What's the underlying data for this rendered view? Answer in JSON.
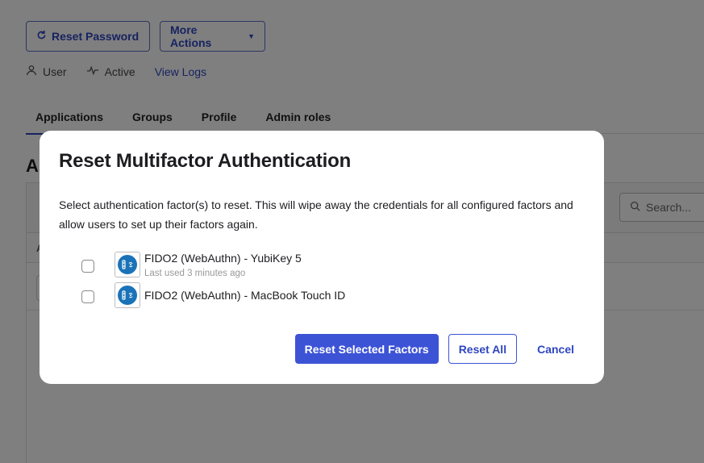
{
  "background": {
    "actions": {
      "reset_password": "Reset Password",
      "more_actions": "More Actions"
    },
    "meta": {
      "role": "User",
      "status": "Active",
      "logs_link": "View Logs"
    },
    "tabs": [
      {
        "label": "Applications",
        "active": true
      },
      {
        "label": "Groups",
        "active": false
      },
      {
        "label": "Profile",
        "active": false
      },
      {
        "label": "Admin roles",
        "active": false
      }
    ],
    "section_title": "As",
    "search_placeholder": "Search...",
    "table_header_partial": "A"
  },
  "modal": {
    "title": "Reset Multifactor Authentication",
    "description": "Select authentication factor(s) to reset. This will wipe away the credentials for all configured factors and allow users to set up their factors again.",
    "factors": [
      {
        "name": "FIDO2 (WebAuthn) - YubiKey 5",
        "last_used": "Last used 3 minutes ago",
        "checked": false
      },
      {
        "name": "FIDO2 (WebAuthn) - MacBook Touch ID",
        "last_used": "",
        "checked": false
      }
    ],
    "buttons": {
      "reset_selected": "Reset Selected Factors",
      "reset_all": "Reset All",
      "cancel": "Cancel"
    }
  },
  "colors": {
    "primary": "#3d53d6",
    "link": "#2f46c0",
    "overlay": "rgba(0,0,0,0.5)",
    "fido_logo": "#1a73b8"
  }
}
